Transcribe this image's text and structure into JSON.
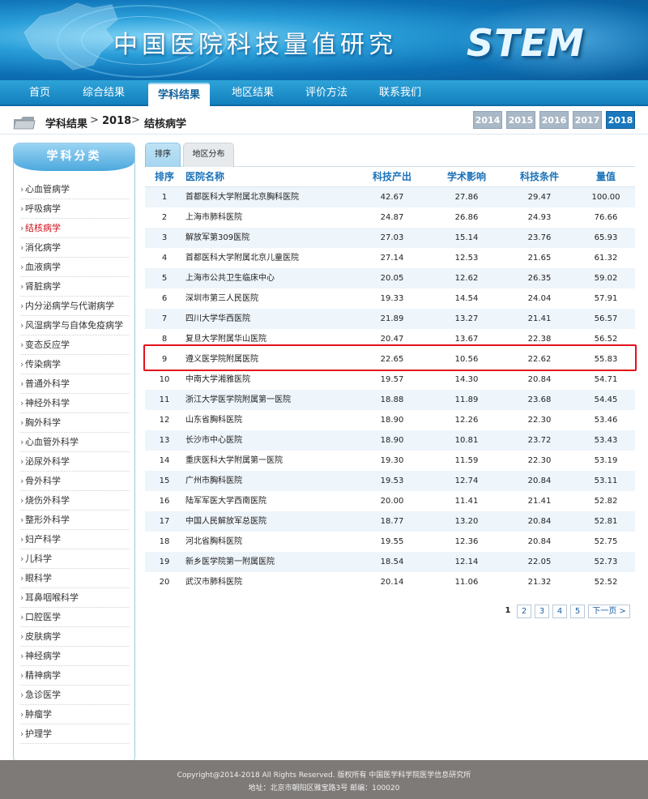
{
  "header": {
    "site_title": "中国医院科技量值研究",
    "logo_text": "STEM"
  },
  "nav": [
    {
      "label": "首页"
    },
    {
      "label": "综合结果"
    },
    {
      "label": "学科结果"
    },
    {
      "label": "地区结果"
    },
    {
      "label": "评价方法"
    },
    {
      "label": "联系我们"
    }
  ],
  "nav_active": "学科结果",
  "breadcrumb": {
    "items": [
      "学科结果",
      "2018",
      "结核病学"
    ],
    "separator": ">"
  },
  "years": [
    "2014",
    "2015",
    "2016",
    "2017",
    "2018"
  ],
  "year_active": "2018",
  "sidebar": {
    "title": "学科分类",
    "bullet": "›",
    "active": "结核病学",
    "items": [
      "心血管病学",
      "呼吸病学",
      "结核病学",
      "消化病学",
      "血液病学",
      "肾脏病学",
      "内分泌病学与代谢病学",
      "风湿病学与自体免疫病学",
      "变态反应学",
      "传染病学",
      "普通外科学",
      "神经外科学",
      "胸外科学",
      "心血管外科学",
      "泌尿外科学",
      "骨外科学",
      "烧伤外科学",
      "整形外科学",
      "妇产科学",
      "儿科学",
      "眼科学",
      "耳鼻咽喉科学",
      "口腔医学",
      "皮肤病学",
      "神经病学",
      "精神病学",
      "急诊医学",
      "肿瘤学",
      "护理学"
    ]
  },
  "tabs": [
    {
      "label": "排序"
    },
    {
      "label": "地区分布"
    }
  ],
  "table": {
    "headers": {
      "rank": "排序",
      "name": "医院名称",
      "tech_output": "科技产出",
      "academic_impact": "学术影响",
      "tech_conditions": "科技条件",
      "score": "量值"
    },
    "highlighted_rank": "9",
    "rows": [
      {
        "rank": "1",
        "name": "首都医科大学附属北京胸科医院",
        "tech_output": "42.67",
        "academic_impact": "27.86",
        "tech_conditions": "29.47",
        "score": "100.00"
      },
      {
        "rank": "2",
        "name": "上海市肺科医院",
        "tech_output": "24.87",
        "academic_impact": "26.86",
        "tech_conditions": "24.93",
        "score": "76.66"
      },
      {
        "rank": "3",
        "name": "解放军第309医院",
        "tech_output": "27.03",
        "academic_impact": "15.14",
        "tech_conditions": "23.76",
        "score": "65.93"
      },
      {
        "rank": "4",
        "name": "首都医科大学附属北京儿童医院",
        "tech_output": "27.14",
        "academic_impact": "12.53",
        "tech_conditions": "21.65",
        "score": "61.32"
      },
      {
        "rank": "5",
        "name": "上海市公共卫生临床中心",
        "tech_output": "20.05",
        "academic_impact": "12.62",
        "tech_conditions": "26.35",
        "score": "59.02"
      },
      {
        "rank": "6",
        "name": "深圳市第三人民医院",
        "tech_output": "19.33",
        "academic_impact": "14.54",
        "tech_conditions": "24.04",
        "score": "57.91"
      },
      {
        "rank": "7",
        "name": "四川大学华西医院",
        "tech_output": "21.89",
        "academic_impact": "13.27",
        "tech_conditions": "21.41",
        "score": "56.57"
      },
      {
        "rank": "8",
        "name": "复旦大学附属华山医院",
        "tech_output": "20.47",
        "academic_impact": "13.67",
        "tech_conditions": "22.38",
        "score": "56.52"
      },
      {
        "rank": "9",
        "name": "遵义医学院附属医院",
        "tech_output": "22.65",
        "academic_impact": "10.56",
        "tech_conditions": "22.62",
        "score": "55.83"
      },
      {
        "rank": "10",
        "name": "中南大学湘雅医院",
        "tech_output": "19.57",
        "academic_impact": "14.30",
        "tech_conditions": "20.84",
        "score": "54.71"
      },
      {
        "rank": "11",
        "name": "浙江大学医学院附属第一医院",
        "tech_output": "18.88",
        "academic_impact": "11.89",
        "tech_conditions": "23.68",
        "score": "54.45"
      },
      {
        "rank": "12",
        "name": "山东省胸科医院",
        "tech_output": "18.90",
        "academic_impact": "12.26",
        "tech_conditions": "22.30",
        "score": "53.46"
      },
      {
        "rank": "13",
        "name": "长沙市中心医院",
        "tech_output": "18.90",
        "academic_impact": "10.81",
        "tech_conditions": "23.72",
        "score": "53.43"
      },
      {
        "rank": "14",
        "name": "重庆医科大学附属第一医院",
        "tech_output": "19.30",
        "academic_impact": "11.59",
        "tech_conditions": "22.30",
        "score": "53.19"
      },
      {
        "rank": "15",
        "name": "广州市胸科医院",
        "tech_output": "19.53",
        "academic_impact": "12.74",
        "tech_conditions": "20.84",
        "score": "53.11"
      },
      {
        "rank": "16",
        "name": "陆军军医大学西南医院",
        "tech_output": "20.00",
        "academic_impact": "11.41",
        "tech_conditions": "21.41",
        "score": "52.82"
      },
      {
        "rank": "17",
        "name": "中国人民解放军总医院",
        "tech_output": "18.77",
        "academic_impact": "13.20",
        "tech_conditions": "20.84",
        "score": "52.81"
      },
      {
        "rank": "18",
        "name": "河北省胸科医院",
        "tech_output": "19.55",
        "academic_impact": "12.36",
        "tech_conditions": "20.84",
        "score": "52.75"
      },
      {
        "rank": "19",
        "name": "新乡医学院第一附属医院",
        "tech_output": "18.54",
        "academic_impact": "12.14",
        "tech_conditions": "22.05",
        "score": "52.73"
      },
      {
        "rank": "20",
        "name": "武汉市肺科医院",
        "tech_output": "20.14",
        "academic_impact": "11.06",
        "tech_conditions": "21.32",
        "score": "52.52"
      }
    ]
  },
  "pagination": {
    "current": "1",
    "pages": [
      "1",
      "2",
      "3",
      "4",
      "5"
    ],
    "next_label": "下一页 >"
  },
  "footer": {
    "line1": "Copyright@2014-2018 All Rights Reserved. 版权所有 中国医学科学院医学信息研究所",
    "line2": "地址：北京市朝阳区雅宝路3号 邮编：100020"
  },
  "colors": {
    "highlight_border": "#e3111a",
    "nav_blue": "#137fbe",
    "active_year": "#1a78bd",
    "header_text": "#1a71b8"
  }
}
